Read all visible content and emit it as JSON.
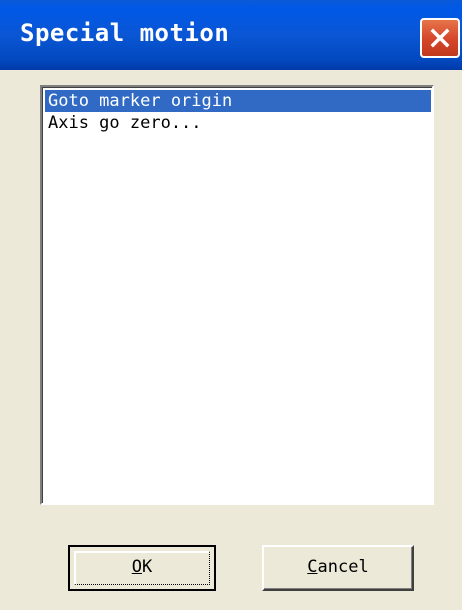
{
  "window": {
    "title": "Special motion"
  },
  "list": {
    "items": [
      {
        "label": "Goto marker origin",
        "selected": true
      },
      {
        "label": "Axis go zero...",
        "selected": false
      }
    ]
  },
  "buttons": {
    "ok": {
      "mnemonic": "O",
      "rest": "K"
    },
    "cancel": {
      "mnemonic": "C",
      "rest": "ancel"
    }
  },
  "colors": {
    "titlebar": "#0a56d4",
    "selection": "#316ac5",
    "close": "#d4462a"
  },
  "icons": {
    "close": "close-icon"
  }
}
